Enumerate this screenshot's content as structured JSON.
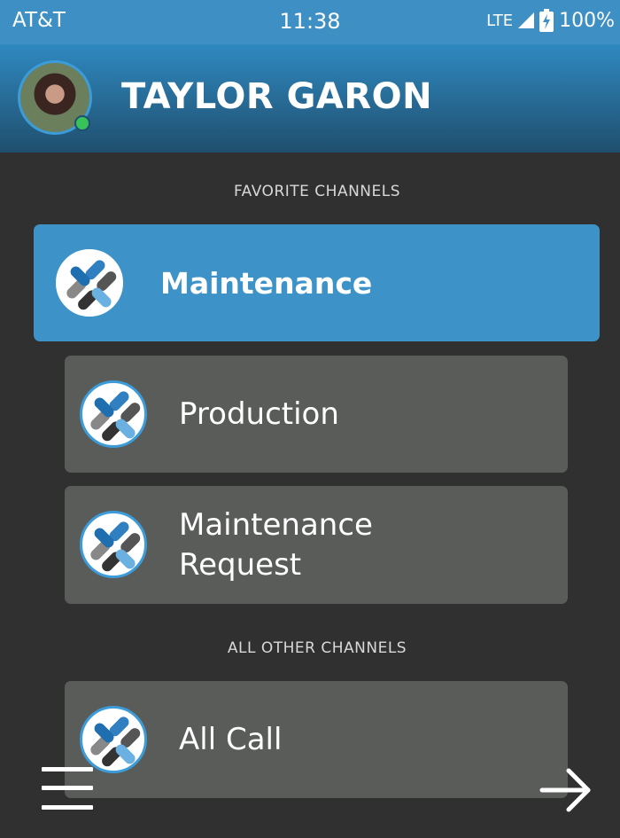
{
  "status_bar": {
    "carrier": "AT&T",
    "time": "11:38",
    "network": "LTE",
    "battery": "100%"
  },
  "header": {
    "user_name": "TAYLOR GARON"
  },
  "favorites": {
    "section_label": "FAVORITE CHANNELS",
    "channels": [
      {
        "label": "Maintenance",
        "active": true
      },
      {
        "label": "Production",
        "active": false
      },
      {
        "label": "Maintenance",
        "label_line2": "Request",
        "active": false
      }
    ]
  },
  "others": {
    "section_label": "ALL OTHER CHANNELS",
    "channels": [
      {
        "label": "All Call"
      }
    ]
  },
  "bottom_bar": {
    "menu_icon": "hamburger-menu-icon",
    "next_icon": "arrow-right-icon"
  },
  "colors": {
    "accent": "#3d93c8",
    "card": "#5a5c5a",
    "background": "#2f302f"
  }
}
